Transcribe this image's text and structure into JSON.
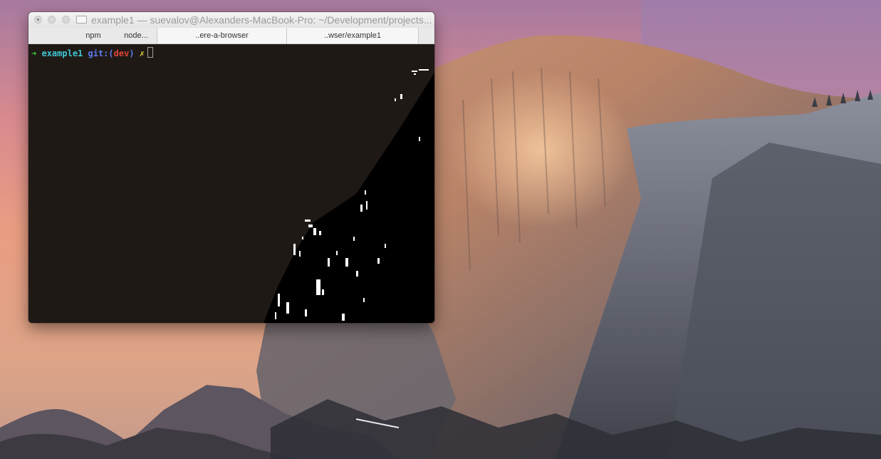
{
  "window": {
    "title": "example1 — suevalov@Alexanders-MacBook-Pro: ~/Development/projects...",
    "tabs": [
      {
        "label": ""
      },
      {
        "label": "npm"
      },
      {
        "label": "node..."
      },
      {
        "label": "..ere-a-browser"
      },
      {
        "label": "..wser/example1"
      }
    ]
  },
  "terminal": {
    "prompt": {
      "arrow": "➜",
      "directory": "example1",
      "git_label": "git:",
      "branch_open": "(",
      "branch": "dev",
      "branch_close": ")",
      "dirty_marker": "✗"
    }
  },
  "colors": {
    "arrow": "#3bd13b",
    "directory": "#3ec6d3",
    "git_label": "#5c7cf0",
    "branch": "#e0443a",
    "dirty_marker": "#e2d43b",
    "terminal_background": "#1f1915"
  }
}
